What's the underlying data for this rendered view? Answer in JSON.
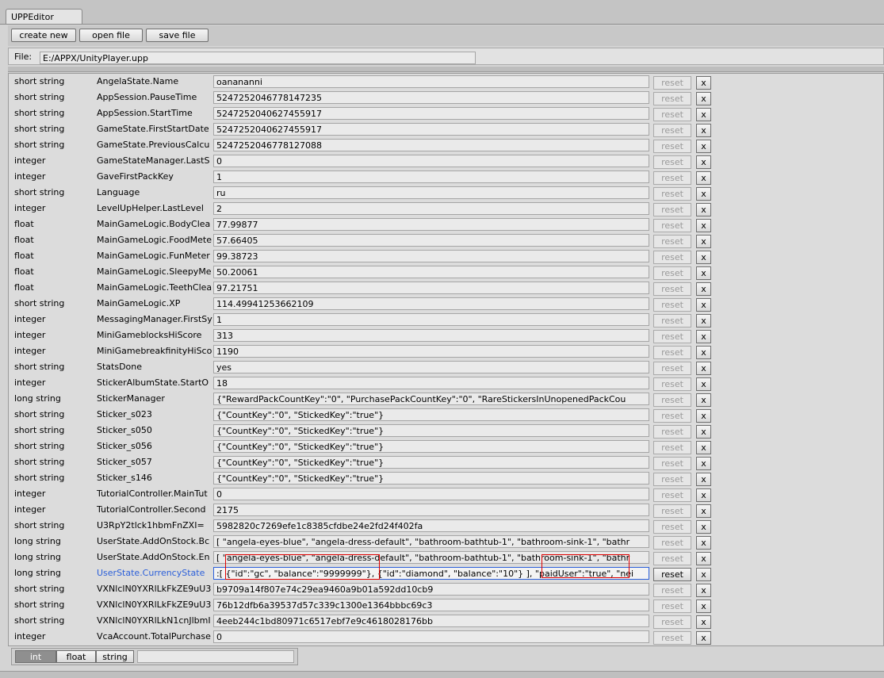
{
  "window": {
    "tab_title": "UPPEditor"
  },
  "toolbar": {
    "create_label": "create new",
    "open_label": "open file",
    "save_label": "save file"
  },
  "file": {
    "label": "File:",
    "path": "E:/APPX/UnityPlayer.upp"
  },
  "rows": [
    {
      "type": "short string",
      "key": "AngelaState.Name",
      "value": "oanananni"
    },
    {
      "type": "short string",
      "key": "AppSession.PauseTime",
      "value": "5247252046778147235"
    },
    {
      "type": "short string",
      "key": "AppSession.StartTime",
      "value": "5247252040627455917"
    },
    {
      "type": "short string",
      "key": "GameState.FirstStartDate",
      "value": "5247252040627455917"
    },
    {
      "type": "short string",
      "key": "GameState.PreviousCalcu",
      "value": "5247252046778127088"
    },
    {
      "type": "integer",
      "key": "GameStateManager.LastS",
      "value": "0"
    },
    {
      "type": "integer",
      "key": "GaveFirstPackKey",
      "value": "1"
    },
    {
      "type": "short string",
      "key": "Language",
      "value": "ru"
    },
    {
      "type": "integer",
      "key": "LevelUpHelper.LastLevel",
      "value": "2"
    },
    {
      "type": "float",
      "key": "MainGameLogic.BodyClea",
      "value": "77.99877"
    },
    {
      "type": "float",
      "key": "MainGameLogic.FoodMete",
      "value": "57.66405"
    },
    {
      "type": "float",
      "key": "MainGameLogic.FunMeter",
      "value": "99.38723"
    },
    {
      "type": "float",
      "key": "MainGameLogic.SleepyMe",
      "value": "50.20061"
    },
    {
      "type": "float",
      "key": "MainGameLogic.TeethClea",
      "value": "97.21751"
    },
    {
      "type": "short string",
      "key": "MainGameLogic.XP",
      "value": "114.49941253662109"
    },
    {
      "type": "integer",
      "key": "MessagingManager.FirstSy",
      "value": "1"
    },
    {
      "type": "integer",
      "key": "MiniGameblocksHiScore",
      "value": "313"
    },
    {
      "type": "integer",
      "key": "MiniGamebreakfinityHiSco",
      "value": "1190"
    },
    {
      "type": "short string",
      "key": "StatsDone",
      "value": "yes"
    },
    {
      "type": "integer",
      "key": "StickerAlbumState.StartO",
      "value": "18"
    },
    {
      "type": "long string",
      "key": "StickerManager",
      "value": "{\"RewardPackCountKey\":\"0\", \"PurchasePackCountKey\":\"0\", \"RareStickersInUnopenedPackCou"
    },
    {
      "type": "short string",
      "key": "Sticker_s023",
      "value": "{\"CountKey\":\"0\", \"StickedKey\":\"true\"}"
    },
    {
      "type": "short string",
      "key": "Sticker_s050",
      "value": "{\"CountKey\":\"0\", \"StickedKey\":\"true\"}"
    },
    {
      "type": "short string",
      "key": "Sticker_s056",
      "value": "{\"CountKey\":\"0\", \"StickedKey\":\"true\"}"
    },
    {
      "type": "short string",
      "key": "Sticker_s057",
      "value": "{\"CountKey\":\"0\", \"StickedKey\":\"true\"}"
    },
    {
      "type": "short string",
      "key": "Sticker_s146",
      "value": "{\"CountKey\":\"0\", \"StickedKey\":\"true\"}"
    },
    {
      "type": "integer",
      "key": "TutorialController.MainTut",
      "value": "0"
    },
    {
      "type": "integer",
      "key": "TutorialController.Second",
      "value": "2175"
    },
    {
      "type": "short string",
      "key": "U3RpY2tlck1hbmFnZXI=",
      "value": "5982820c7269efe1c8385cfdbe24e2fd24f402fa"
    },
    {
      "type": "long string",
      "key": "UserState.AddOnStock.Bc",
      "value": "[ \"angela-eyes-blue\", \"angela-dress-default\", \"bathroom-bathtub-1\", \"bathroom-sink-1\", \"bathr"
    },
    {
      "type": "long string",
      "key": "UserState.AddOnStock.En",
      "value": "[ \"angela-eyes-blue\", \"angela-dress-default\", \"bathroom-bathtub-1\", \"bathroom-sink-1\", \"bathr"
    },
    {
      "type": "long string",
      "key": "UserState.CurrencyState",
      "value": ":[ {\"id\":\"gc\", \"balance\":\"9999999\"}, {\"id\":\"diamond\", \"balance\":\"10\"} ], \"paidUser\":\"true\", \"nei",
      "active": true
    },
    {
      "type": "short string",
      "key": "VXNlclN0YXRlLkFkZE9uU3",
      "value": "b9709a14f807e74c29ea9460a9b01a592dd10cb9"
    },
    {
      "type": "short string",
      "key": "VXNlclN0YXRlLkFkZE9uU3",
      "value": "76b12dfb6a39537d57c339c1300e1364bbbc69c3"
    },
    {
      "type": "short string",
      "key": "VXNlclN0YXRlLkN1cnJlbmI",
      "value": "4eeb244c1bd80971c6517ebf7e9c4618028176bb"
    },
    {
      "type": "integer",
      "key": "VcaAccount.TotalPurchase",
      "value": "0"
    }
  ],
  "row_buttons": {
    "reset_label": "reset",
    "delete_label": "x"
  },
  "type_selector": {
    "options": [
      "int",
      "float",
      "string"
    ],
    "selected": "int"
  }
}
